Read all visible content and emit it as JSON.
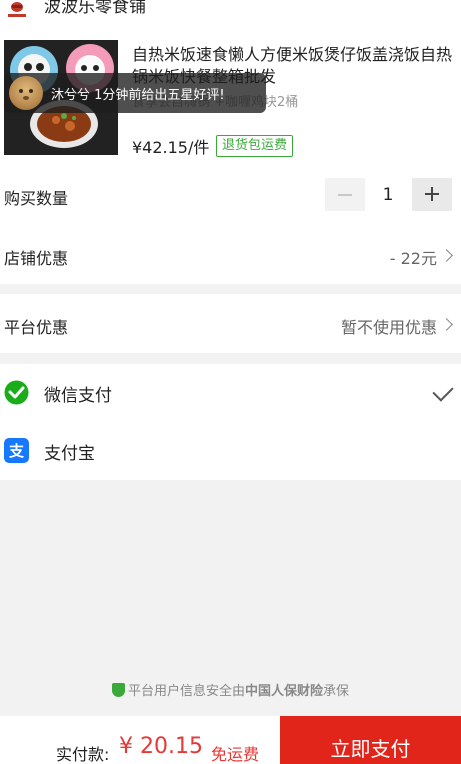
{
  "shop": {
    "name": "波波乐零食铺",
    "logo_icon": "shop-logo-icon"
  },
  "product": {
    "title": "自热米饭速食懒人方便米饭煲仔饭盖浇饭自热锅米饭快餐整箱批发",
    "spec": "食享会自嗨锅 +咖喱鸡块2桶",
    "price": "¥42.15/件",
    "refund_badge": "退货包运费"
  },
  "toast": {
    "text": "沐兮兮 1分钟前给出五星好评!"
  },
  "quantity": {
    "label": "购买数量",
    "value": "1"
  },
  "shop_discount": {
    "label": "店铺优惠",
    "value": "- 22元"
  },
  "platform_discount": {
    "label": "平台优惠",
    "value": "暂不使用优惠"
  },
  "payment_methods": [
    {
      "label": "微信支付",
      "icon": "wechat-pay-icon",
      "color": "#1aad19",
      "selected": true
    },
    {
      "label": "支付宝",
      "icon": "alipay-icon",
      "color": "#1677ff",
      "selected": false
    }
  ],
  "security": {
    "text": "平台用户信息安全由",
    "insurer": "中国人保财险",
    "suffix": "承保"
  },
  "footer": {
    "total_label": "实付款:",
    "total_amount": "¥ 20.15",
    "free_shipping": "免运费",
    "pay_button": "立即支付"
  },
  "colors": {
    "accent_red": "#e1251b",
    "price_red": "#e53935",
    "badge_green": "#3aa93a"
  }
}
